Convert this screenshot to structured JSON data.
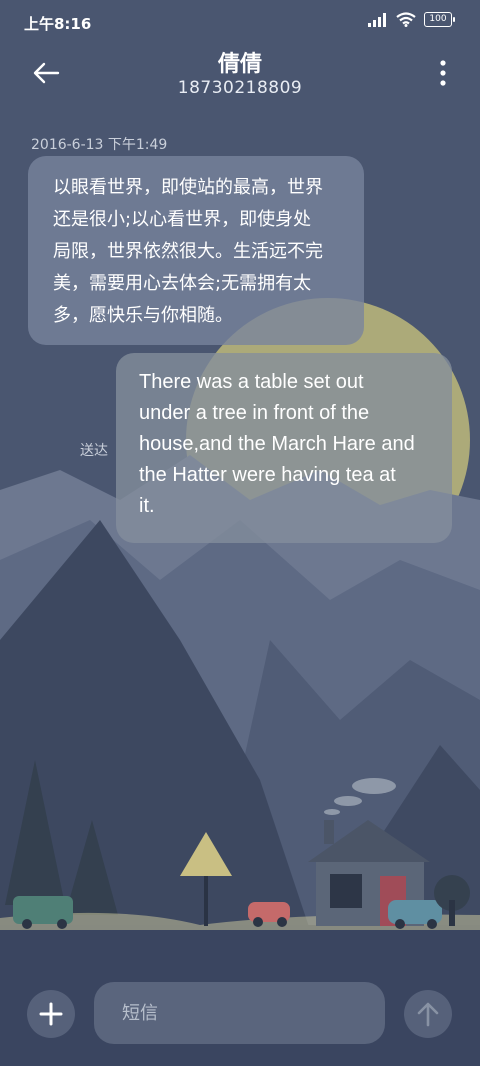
{
  "status_bar": {
    "time": "上午8:16",
    "battery": "100",
    "icons": [
      "signal-icon",
      "wifi-icon",
      "battery-icon"
    ]
  },
  "header": {
    "contact_name": "倩倩",
    "phone_number": "18730218809",
    "back_icon": "back-arrow-icon",
    "more_icon": "more-vertical-icon"
  },
  "conversation": {
    "timestamp": "2016-6-13 下午1:49",
    "incoming": {
      "lines": [
        "以眼看世界，即使站的最高，世界",
        "还是很小;以心看世界，即使身处",
        "局限，世界依然很大。生活远不完",
        "美，需要用心去体会;无需拥有太",
        "多，愿快乐与你相随。"
      ]
    },
    "outgoing": {
      "lines": [
        "There was a table set out",
        "under a tree in front of the",
        "house,and the March Hare and",
        "the Hatter were having tea at",
        "it."
      ],
      "status": "送达"
    }
  },
  "composer": {
    "placeholder": "短信",
    "add_icon": "plus-icon",
    "send_icon": "send-arrow-icon"
  },
  "colors": {
    "background": "#4a5670",
    "bubble_incoming": "#78849e",
    "bubble_outgoing": "#848e9c",
    "moon": "#c8c27a"
  }
}
